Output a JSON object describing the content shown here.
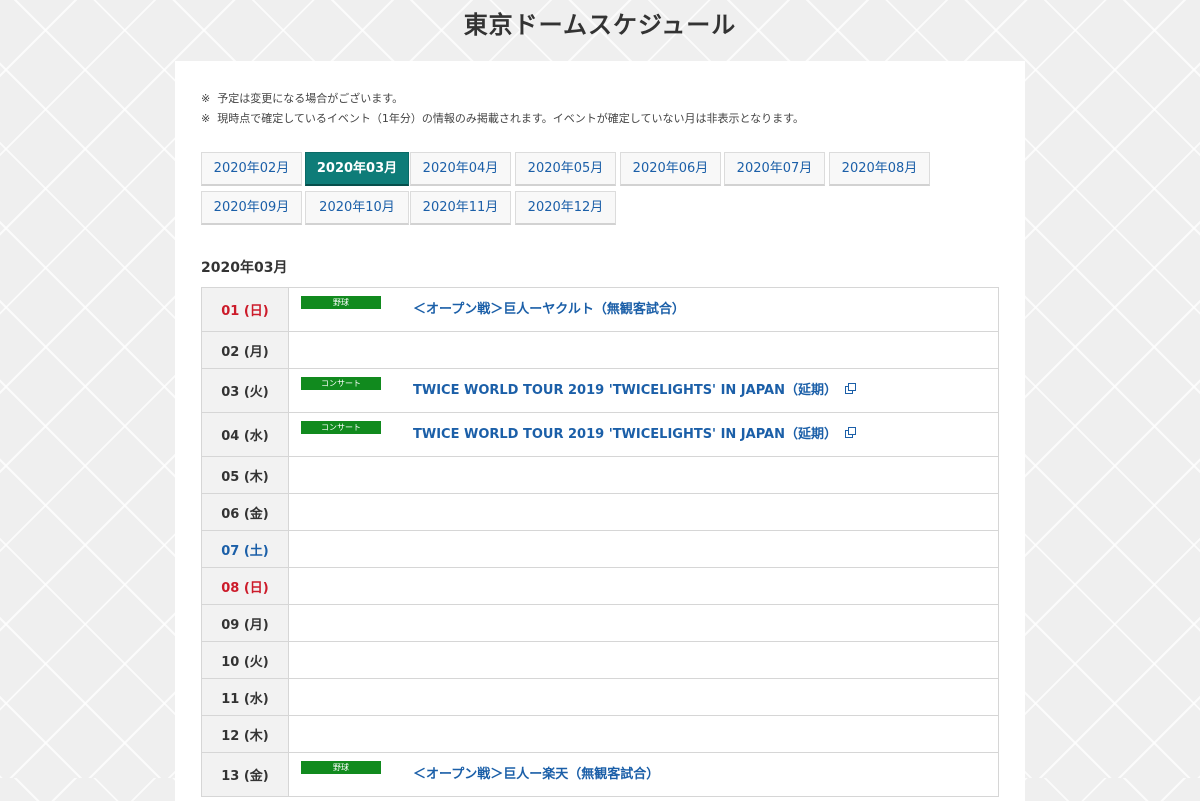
{
  "page": {
    "title": "東京ドームスケジュール"
  },
  "notes": [
    {
      "mark": "※",
      "text": "予定は変更になる場合がございます。"
    },
    {
      "mark": "※",
      "text": "現時点で確定しているイベント（1年分）の情報のみ掲載されます。イベントが確定していない月は非表示となります。"
    }
  ],
  "month_tabs": [
    {
      "label": "2020年02月",
      "active": false
    },
    {
      "label": "2020年03月",
      "active": true
    },
    {
      "label": "2020年04月",
      "active": false
    },
    {
      "label": "2020年05月",
      "active": false
    },
    {
      "label": "2020年06月",
      "active": false
    },
    {
      "label": "2020年07月",
      "active": false
    },
    {
      "label": "2020年08月",
      "active": false
    },
    {
      "label": "2020年09月",
      "active": false
    },
    {
      "label": "2020年10月",
      "active": false
    },
    {
      "label": "2020年11月",
      "active": false
    },
    {
      "label": "2020年12月",
      "active": false
    }
  ],
  "current_month": "2020年03月",
  "colors": {
    "active_tab": "#0e7c78",
    "link": "#1b5fa8",
    "sunday": "#cc1b2a",
    "saturday": "#1b5fa8",
    "badge": "#118a1e"
  },
  "schedule": [
    {
      "date": "01 (日)",
      "day_type": "sun",
      "badge": "野球",
      "title": "＜オープン戦＞巨人ーヤクルト（無観客試合）",
      "copy_icon": false
    },
    {
      "date": "02 (月)",
      "day_type": "weekday"
    },
    {
      "date": "03 (火)",
      "day_type": "weekday",
      "badge": "コンサート",
      "title": "TWICE WORLD TOUR 2019 'TWICELIGHTS' IN JAPAN（延期）",
      "copy_icon": true
    },
    {
      "date": "04 (水)",
      "day_type": "weekday",
      "badge": "コンサート",
      "title": "TWICE WORLD TOUR 2019 'TWICELIGHTS' IN JAPAN（延期）",
      "copy_icon": true
    },
    {
      "date": "05 (木)",
      "day_type": "weekday"
    },
    {
      "date": "06 (金)",
      "day_type": "weekday"
    },
    {
      "date": "07 (土)",
      "day_type": "sat"
    },
    {
      "date": "08 (日)",
      "day_type": "sun"
    },
    {
      "date": "09 (月)",
      "day_type": "weekday"
    },
    {
      "date": "10 (火)",
      "day_type": "weekday"
    },
    {
      "date": "11 (水)",
      "day_type": "weekday"
    },
    {
      "date": "12 (木)",
      "day_type": "weekday"
    },
    {
      "date": "13 (金)",
      "day_type": "weekday",
      "badge": "野球",
      "title": "＜オープン戦＞巨人ー楽天（無観客試合）",
      "copy_icon": false
    }
  ]
}
